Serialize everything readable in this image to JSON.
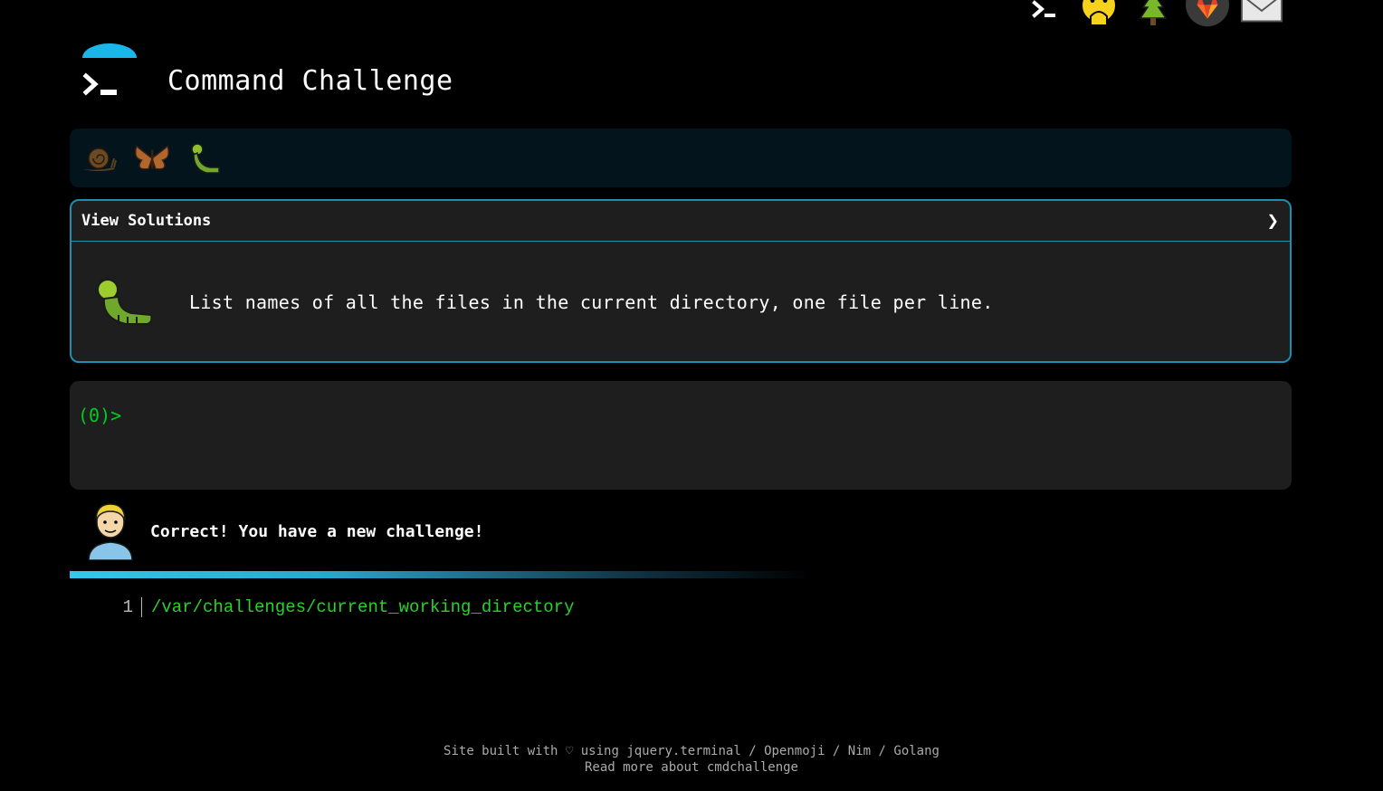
{
  "site": {
    "title": "Command Challenge"
  },
  "header_icons": [
    {
      "name": "terminal-icon"
    },
    {
      "name": "face-hand-over-mouth-icon"
    },
    {
      "name": "tree-icon"
    },
    {
      "name": "gitlab-icon"
    },
    {
      "name": "envelope-icon"
    }
  ],
  "progress_icons": [
    "snail-icon",
    "butterfly-icon",
    "caterpillar-icon"
  ],
  "challenge": {
    "view_solutions_label": "View Solutions",
    "chevron": "❯",
    "task": "List names of all the files in the current directory, one file per line."
  },
  "terminal": {
    "prompt": "(0)>"
  },
  "feedback": {
    "message": "Correct! You have a new challenge!"
  },
  "output": {
    "line_number": "1",
    "path": "/var/challenges/current_working_directory"
  },
  "footer": {
    "line1_prefix": "Site built with ♡ using ",
    "link_jquery": "jquery.terminal",
    "sep1": " / ",
    "link_openmoji": "Openmoji",
    "sep2": " / ",
    "link_nim": "Nim",
    "sep3": " / ",
    "link_golang": "Golang",
    "line2_link": "Read more about cmdchallenge"
  },
  "colors": {
    "accent": "#1b8fb0",
    "prompt": "#00cc22",
    "path": "#2ad12a"
  }
}
